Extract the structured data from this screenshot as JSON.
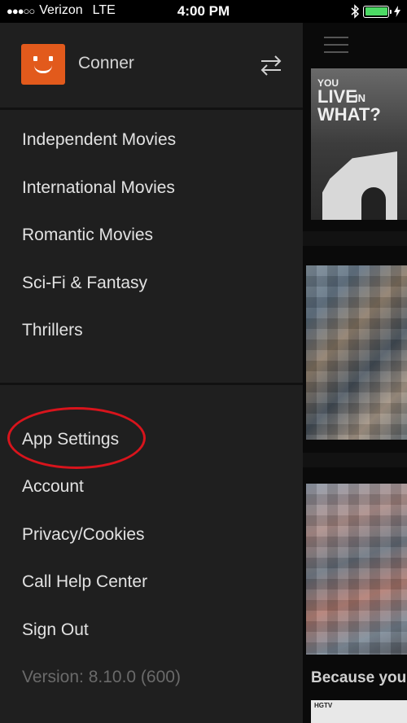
{
  "status_bar": {
    "signal": "●●●○○",
    "carrier": "Verizon",
    "network": "LTE",
    "time": "4:00 PM",
    "battery_level": 1.0,
    "battery_color": "#4cd964"
  },
  "profile": {
    "name": "Conner",
    "avatar_color": "#e25a1c",
    "switch_icon": "swap-arrows-icon"
  },
  "genres": [
    "Independent Movies",
    "International Movies",
    "Romantic Movies",
    "Sci-Fi & Fantasy",
    "Thrillers"
  ],
  "settings_menu": [
    "App Settings",
    "Account",
    "Privacy/Cookies",
    "Call Help Center",
    "Sign Out"
  ],
  "version": "Version: 8.10.0 (600)",
  "highlight_color": "#d8141c",
  "background": {
    "poster_text": [
      "YOU",
      "LIVE",
      "IN",
      "WHAT?"
    ],
    "row_title": "Because you",
    "thumb_brand": "HGTV"
  }
}
